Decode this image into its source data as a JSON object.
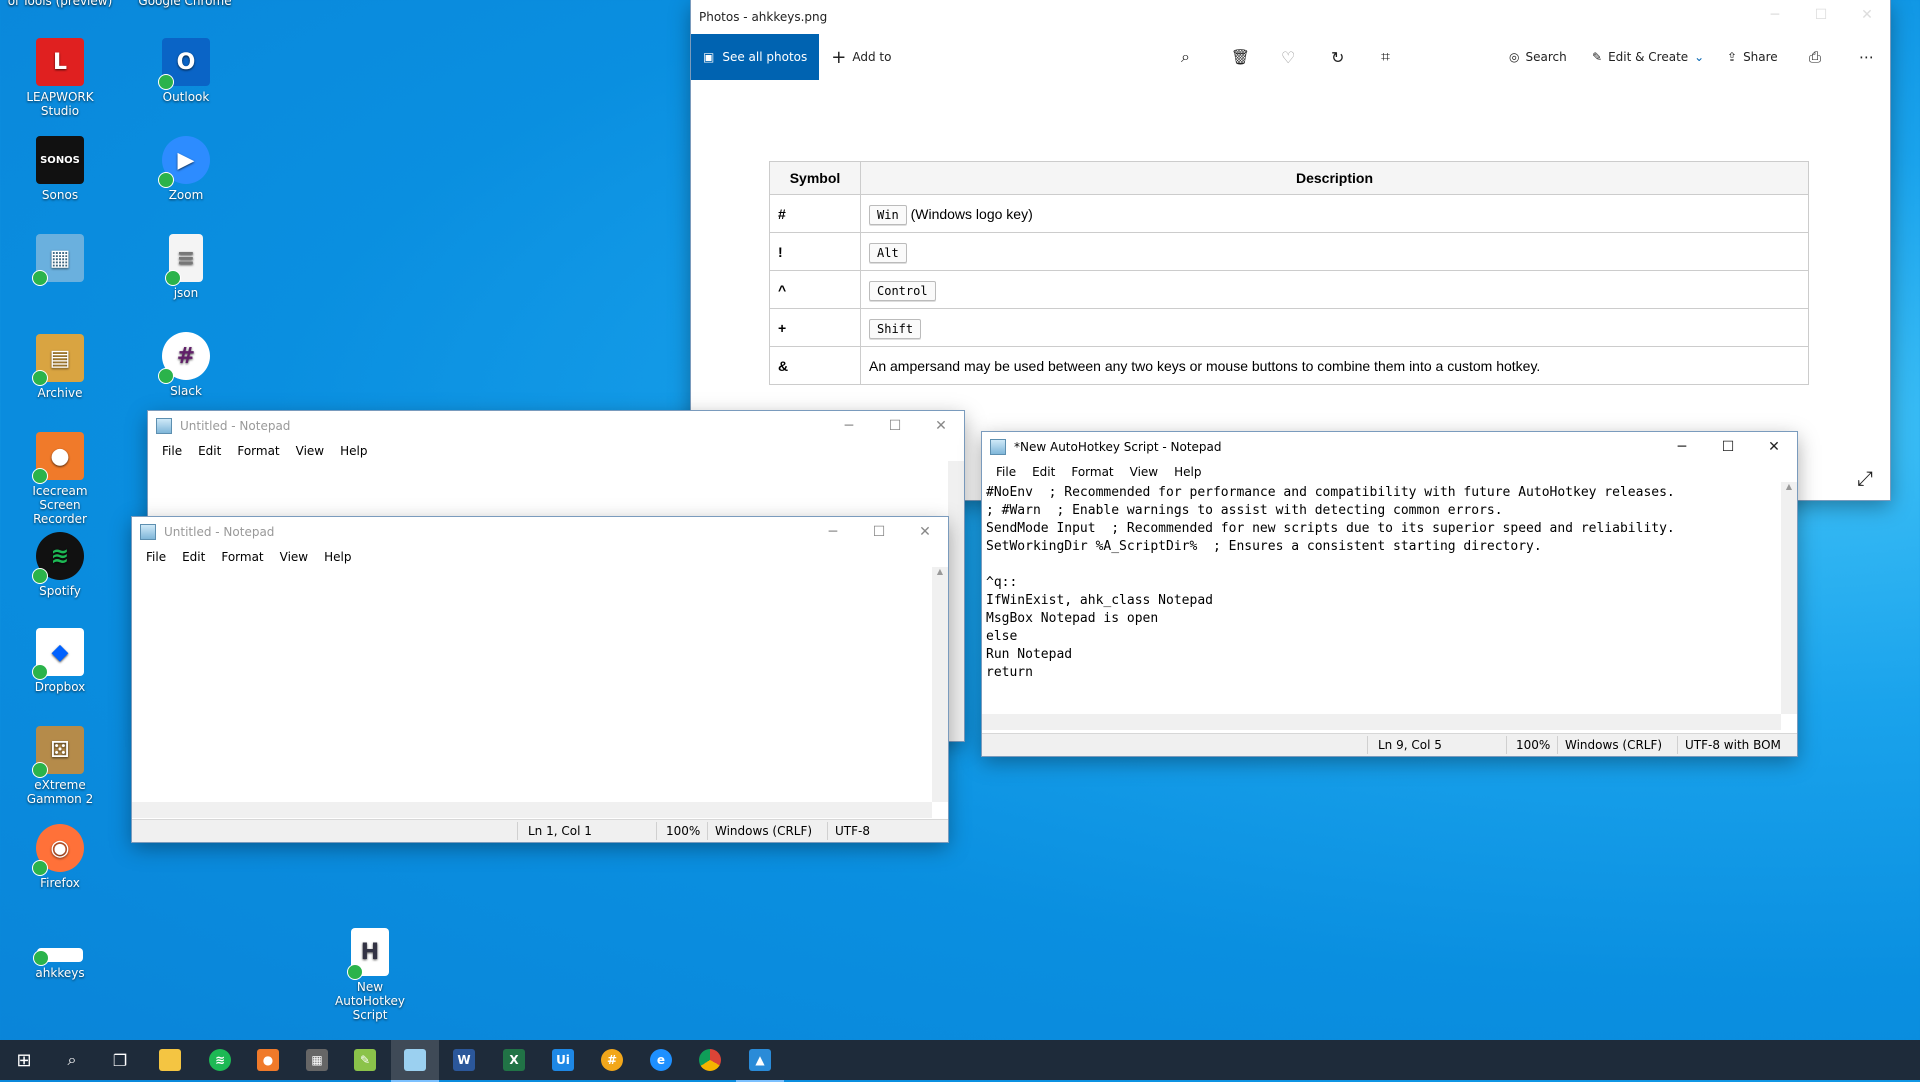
{
  "desktop": {
    "icons": [
      {
        "label": "LEAPWORK Studio",
        "color": "#e02020",
        "glyph": "L"
      },
      {
        "label": "Outlook",
        "color": "#0a64c6",
        "glyph": "O"
      },
      {
        "label": "Sonos",
        "color": "#111111",
        "glyph": "SONOS"
      },
      {
        "label": "Zoom",
        "color": "#2d8cff",
        "glyph": "▶"
      },
      {
        "label": "",
        "color": "#6ab0de",
        "glyph": "▦"
      },
      {
        "label": "json",
        "color": "#f4f4f4",
        "glyph": "≡"
      },
      {
        "label": "Archive",
        "color": "#d9a441",
        "glyph": "▤"
      },
      {
        "label": "Slack",
        "color": "#ffffff",
        "glyph": "#"
      },
      {
        "label": "Icecream Screen Recorder",
        "color": "#f07a2a",
        "glyph": "●"
      },
      {
        "label": "Spotify",
        "color": "#1db954",
        "glyph": "≋"
      },
      {
        "label": "Dropbox",
        "color": "#ffffff",
        "glyph": "◆"
      },
      {
        "label": "eXtreme Gammon 2",
        "color": "#b58b4a",
        "glyph": "⚄"
      },
      {
        "label": "Firefox",
        "color": "#ff7139",
        "glyph": "◉"
      },
      {
        "label": "ahkkeys",
        "color": "#ffffff",
        "glyph": ""
      },
      {
        "label": "New AutoHotkey Script",
        "color": "#ffffff",
        "glyph": "H"
      }
    ],
    "partial_top_labels": [
      "ol Tools (preview)",
      "Google Chrome"
    ]
  },
  "photos": {
    "title": "Photos - ahkkeys.png",
    "see_all": "See all photos",
    "add_to": "Add to",
    "search": "Search",
    "edit_create": "Edit & Create",
    "share": "Share",
    "table": {
      "headers": [
        "Symbol",
        "Description"
      ],
      "rows": [
        {
          "symbol": "#",
          "key": "Win",
          "desc": "(Windows logo key)"
        },
        {
          "symbol": "!",
          "key": "Alt",
          "desc": ""
        },
        {
          "symbol": "^",
          "key": "Control",
          "desc": ""
        },
        {
          "symbol": "+",
          "key": "Shift",
          "desc": ""
        },
        {
          "symbol": "&",
          "key": "",
          "desc": "An ampersand may be used between any two keys or mouse buttons to combine them into a custom hotkey."
        }
      ]
    }
  },
  "notepad_back": {
    "title": "Untitled - Notepad",
    "menu": [
      "File",
      "Edit",
      "Format",
      "View",
      "Help"
    ]
  },
  "notepad_front": {
    "title": "Untitled - Notepad",
    "menu": [
      "File",
      "Edit",
      "Format",
      "View",
      "Help"
    ],
    "status": {
      "pos": "Ln 1, Col 1",
      "zoom": "100%",
      "eol": "Windows (CRLF)",
      "enc": "UTF-8"
    }
  },
  "notepad_ahk": {
    "title": "*New AutoHotkey Script - Notepad",
    "menu": [
      "File",
      "Edit",
      "Format",
      "View",
      "Help"
    ],
    "content": "#NoEnv  ; Recommended for performance and compatibility with future AutoHotkey releases.\n; #Warn  ; Enable warnings to assist with detecting common errors.\nSendMode Input  ; Recommended for new scripts due to its superior speed and reliability.\nSetWorkingDir %A_ScriptDir%  ; Ensures a consistent starting directory.\n\n^q::\nIfWinExist, ahk_class Notepad\nMsgBox Notepad is open\nelse\nRun Notepad\nreturn",
    "status": {
      "pos": "Ln 9, Col 5",
      "zoom": "100%",
      "eol": "Windows (CRLF)",
      "enc": "UTF-8 with BOM"
    }
  },
  "taskbar": {
    "items": [
      "start-icon",
      "search-icon",
      "task-view-icon",
      "file-explorer-icon",
      "spotify-icon",
      "icecream-icon",
      "calculator-icon",
      "notepadpp-icon",
      "notepad-icon",
      "word-icon",
      "excel-icon",
      "uipath-icon",
      "slack-icon",
      "edge-icon",
      "chrome-icon",
      "photos-icon"
    ]
  }
}
